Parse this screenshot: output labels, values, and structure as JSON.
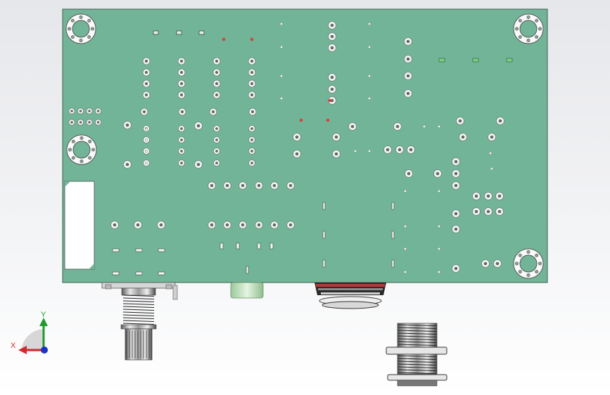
{
  "viewport": {
    "name": "cad-3d-viewport",
    "background_top": "#e6e7ea",
    "background_bottom": "#ffffff"
  },
  "pcb": {
    "board_color": "#72b497",
    "board_edge": "#3f5e4f",
    "pad_color": "#f4f4f4",
    "pad_ring": "#6f8379",
    "marker_color_red": "#d3443a",
    "marker_color_green": "#77d17a"
  },
  "triad": {
    "x_label": "X",
    "y_label": "Y",
    "x_color": "#d22a2a",
    "y_color": "#1f9b2e",
    "z_color": "#1733c8"
  },
  "components": {
    "potentiometer": "potentiometer-shaft",
    "jack_center": "audio-jack",
    "jack_bottom": "threaded-jack-nut",
    "led": "green-led-stub"
  }
}
